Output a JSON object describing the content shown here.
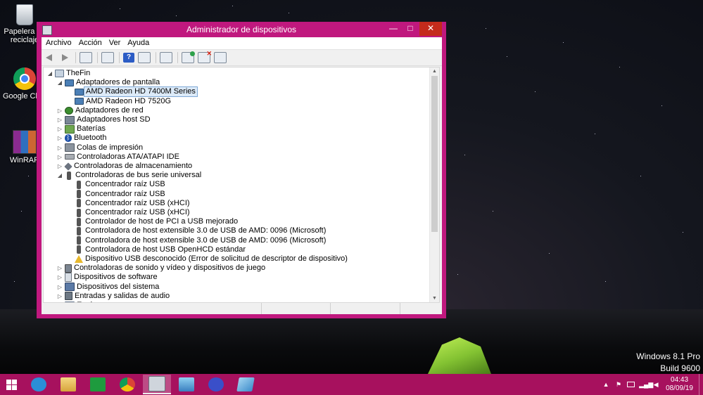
{
  "desktop": {
    "icons": [
      {
        "label": "Papelera de reciclaje",
        "icon": "recycle-bin-icon"
      },
      {
        "label": "Google Chrome",
        "icon": "chrome-icon"
      },
      {
        "label": "WinRAR",
        "icon": "winrar-icon"
      }
    ],
    "watermark": {
      "line1": "Windows 8.1 Pro",
      "line2": "Build 9600"
    }
  },
  "window": {
    "title": "Administrador de dispositivos",
    "controls": {
      "minimize": "—",
      "maximize": "□",
      "close": "✕"
    },
    "menu": [
      "Archivo",
      "Acción",
      "Ver",
      "Ayuda"
    ],
    "toolbar": [
      "back-icon",
      "forward-icon",
      "properties-grid-icon",
      "view-icon",
      "help-icon",
      "details-icon",
      "display-icon",
      "update-driver-icon",
      "uninstall-icon",
      "scan-hardware-icon"
    ],
    "tree": [
      {
        "label": "TheFin",
        "level": 0,
        "expander": "◢",
        "icon": "computer"
      },
      {
        "label": "Adaptadores de pantalla",
        "level": 1,
        "expander": "◢",
        "icon": "monitor"
      },
      {
        "label": "AMD Radeon HD 7400M Series",
        "level": 2,
        "expander": "",
        "icon": "monitor",
        "selected": true
      },
      {
        "label": "AMD Radeon HD 7520G",
        "level": 2,
        "expander": "",
        "icon": "monitor"
      },
      {
        "label": "Adaptadores de red",
        "level": 1,
        "expander": "▷",
        "icon": "network"
      },
      {
        "label": "Adaptadores host SD",
        "level": 1,
        "expander": "▷",
        "icon": "sd"
      },
      {
        "label": "Baterías",
        "level": 1,
        "expander": "▷",
        "icon": "battery"
      },
      {
        "label": "Bluetooth",
        "level": 1,
        "expander": "▷",
        "icon": "bluetooth"
      },
      {
        "label": "Colas de impresión",
        "level": 1,
        "expander": "▷",
        "icon": "printer"
      },
      {
        "label": "Controladoras ATA/ATAPI IDE",
        "level": 1,
        "expander": "▷",
        "icon": "ide"
      },
      {
        "label": "Controladoras de almacenamiento",
        "level": 1,
        "expander": "▷",
        "icon": "storage"
      },
      {
        "label": "Controladoras de bus serie universal",
        "level": 1,
        "expander": "◢",
        "icon": "usb"
      },
      {
        "label": "Concentrador raíz USB",
        "level": 2,
        "expander": "",
        "icon": "usb"
      },
      {
        "label": "Concentrador raíz USB",
        "level": 2,
        "expander": "",
        "icon": "usb"
      },
      {
        "label": "Concentrador raíz USB (xHCI)",
        "level": 2,
        "expander": "",
        "icon": "usb"
      },
      {
        "label": "Concentrador raíz USB (xHCI)",
        "level": 2,
        "expander": "",
        "icon": "usb"
      },
      {
        "label": "Controlador de host de PCI a USB mejorado",
        "level": 2,
        "expander": "",
        "icon": "usb"
      },
      {
        "label": "Controladora de host extensible 3.0 de USB de AMD: 0096 (Microsoft)",
        "level": 2,
        "expander": "",
        "icon": "usb"
      },
      {
        "label": "Controladora de host extensible 3.0 de USB de AMD: 0096 (Microsoft)",
        "level": 2,
        "expander": "",
        "icon": "usb"
      },
      {
        "label": "Controladora de host USB OpenHCD estándar",
        "level": 2,
        "expander": "",
        "icon": "usb"
      },
      {
        "label": "Dispositivo USB desconocido (Error de solicitud de descriptor de dispositivo)",
        "level": 2,
        "expander": "",
        "icon": "warning"
      },
      {
        "label": "Controladoras de sonido y vídeo y dispositivos de juego",
        "level": 1,
        "expander": "▷",
        "icon": "sound"
      },
      {
        "label": "Dispositivos de software",
        "level": 1,
        "expander": "▷",
        "icon": "software"
      },
      {
        "label": "Dispositivos del sistema",
        "level": 1,
        "expander": "▷",
        "icon": "system"
      },
      {
        "label": "Entradas y salidas de audio",
        "level": 1,
        "expander": "▷",
        "icon": "audio"
      },
      {
        "label": "Equipo",
        "level": 1,
        "expander": "▷",
        "icon": "equipment"
      }
    ]
  },
  "taskbar": {
    "apps": [
      "internet-explorer-icon",
      "file-explorer-icon",
      "store-icon",
      "chrome-icon",
      "device-manager-icon",
      "photos-icon",
      "settings-icon",
      "notes-icon"
    ],
    "active": "device-manager-icon",
    "tray": {
      "chevron": "▲",
      "flag": "⚑",
      "time": "04:43",
      "date": "08/09/19"
    }
  },
  "colors": {
    "accent": "#c0187e",
    "taskbar": "#a7115e",
    "selection": "#dceaf8"
  }
}
